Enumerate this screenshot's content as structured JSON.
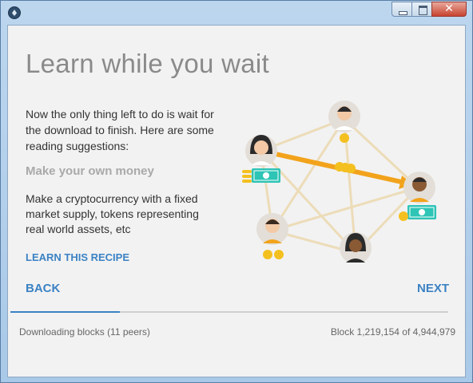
{
  "window": {
    "title": "",
    "icon": "app-icon",
    "controls": [
      "minimize-icon",
      "maximize-icon",
      "close-icon"
    ],
    "close_glyph": "✕"
  },
  "page": {
    "title": "Learn while you wait",
    "intro": "Now the only thing left to do is wait for the download to finish. Here are some reading suggestions:"
  },
  "recipe": {
    "title": "Make your own money",
    "description": "Make a cryptocurrency with a fixed market supply, tokens representing real world assets, etc",
    "link_label": "LEARN THIS RECIPE"
  },
  "nav": {
    "back_label": "BACK",
    "next_label": "NEXT"
  },
  "progress": {
    "fraction": 0.25
  },
  "status": {
    "peers_text": "Downloading blocks (11 peers)",
    "block_text": "Block 1,219,154 of 4,944,979"
  },
  "colors": {
    "accent": "#3b82c4",
    "arrow": "#f2a31b",
    "link_lines": "#ecdcb8",
    "money": "#2ec4b6",
    "coin": "#f4c020",
    "avatar_bg": "#e3ded7"
  },
  "illustration": {
    "icon": "peer-network-illustration"
  }
}
